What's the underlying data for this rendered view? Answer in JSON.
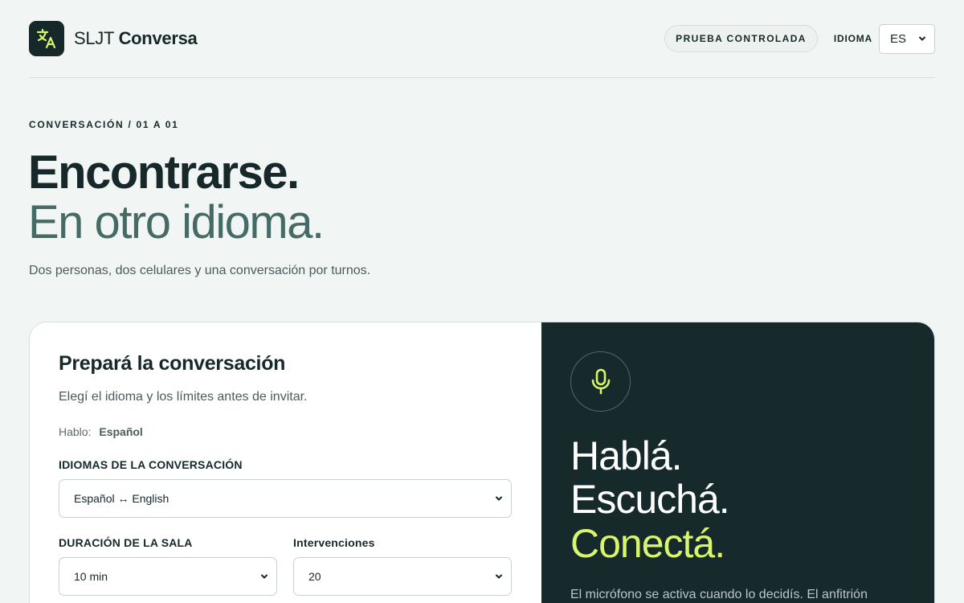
{
  "header": {
    "brand_light": "SLJT",
    "brand_strong": "Conversa",
    "badge": "PRUEBA CONTROLADA",
    "language_label": "IDIOMA",
    "language_value": "ES",
    "logo_icon": "translate-icon"
  },
  "hero": {
    "eyebrow": "CONVERSACIÓN / 01 A 01",
    "line1": "Encontrarse.",
    "line2": "En otro idioma.",
    "subtitle": "Dos personas, dos celulares y una conversación por turnos."
  },
  "setup": {
    "title": "Prepará la conversación",
    "subtitle": "Elegí el idioma y los límites antes de invitar.",
    "speak_label": "Hablo:",
    "speak_value": "Español",
    "languages_label": "IDIOMAS DE LA CONVERSACIÓN",
    "languages_value": "Español ↔ English",
    "duration_label": "DURACIÓN DE LA SALA",
    "duration_value": "10 min",
    "turns_label": "Intervenciones",
    "turns_value": "20"
  },
  "promo": {
    "icon": "microphone-icon",
    "line1": "Hablá.",
    "line2": "Escuchá.",
    "line3": "Conectá.",
    "description": "El micrófono se activa cuando lo decidís. El anfitrión"
  },
  "colors": {
    "dark": "#16292b",
    "accent": "#d9f56a",
    "muted_green": "#466b66",
    "background": "#f1f5f3"
  }
}
